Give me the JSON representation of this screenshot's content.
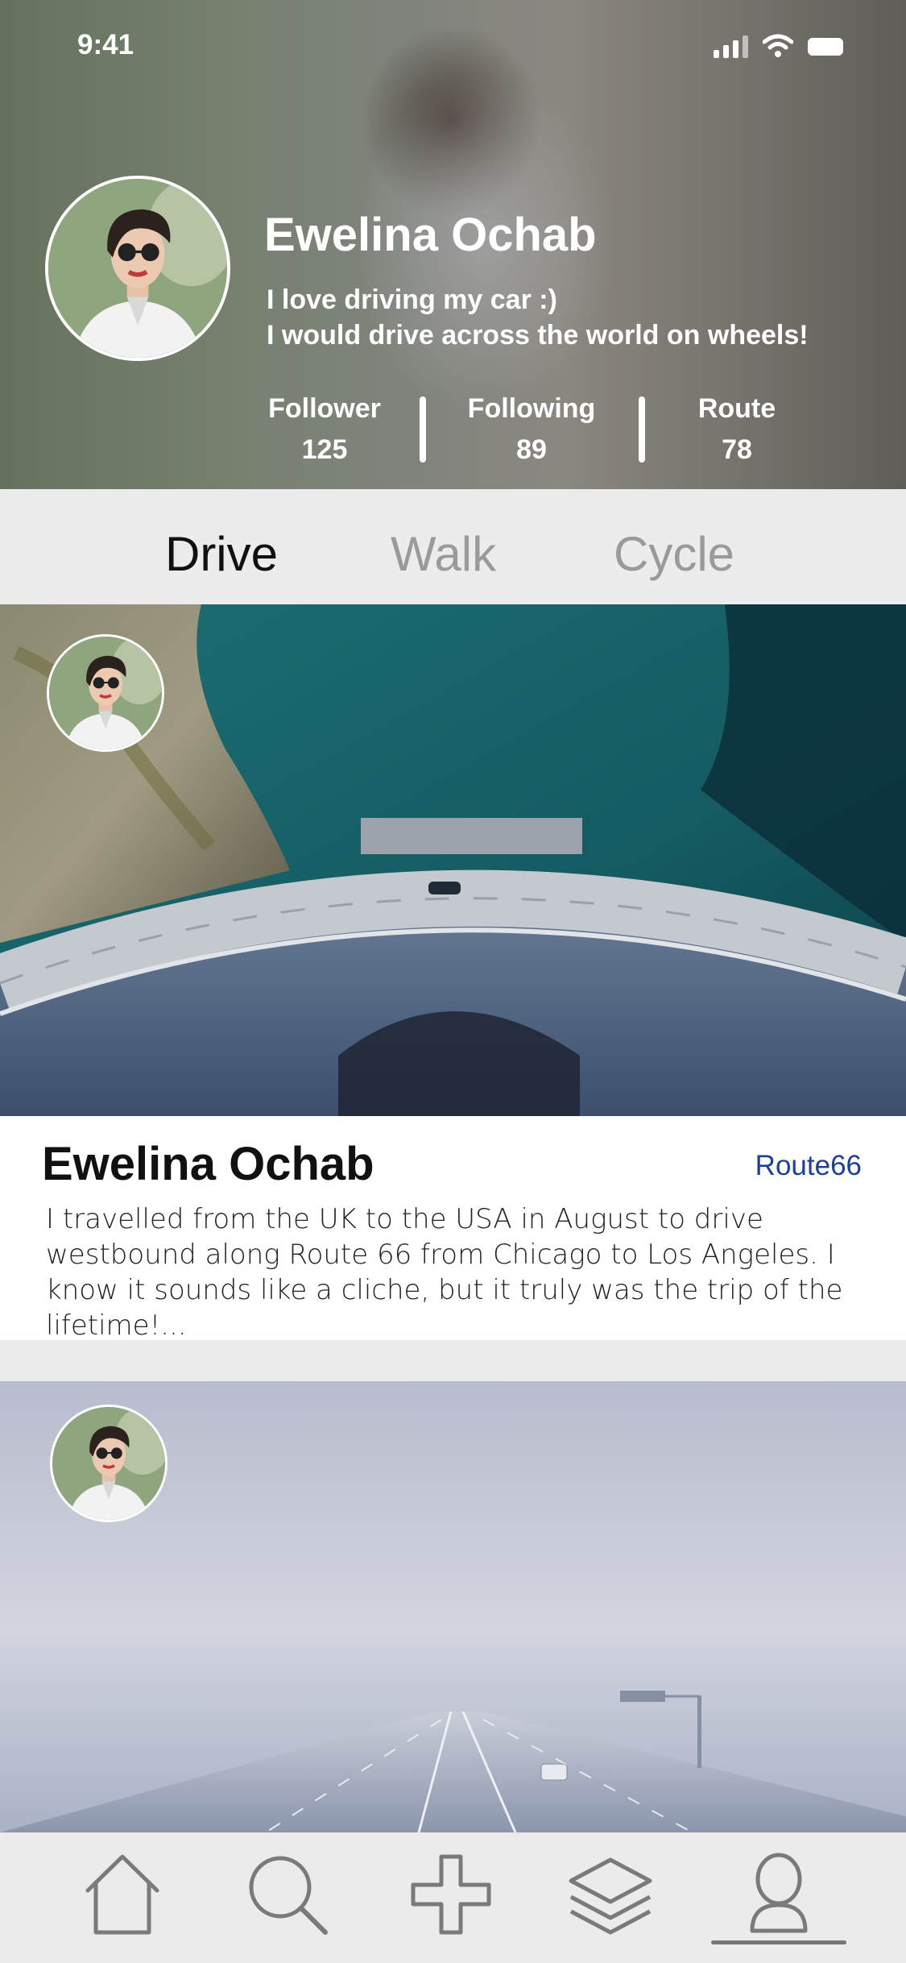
{
  "status_bar": {
    "time": "9:41"
  },
  "profile": {
    "name": "Ewelina Ochab",
    "bio_line1": "I love driving my car :)",
    "bio_line2": "I would drive across the world on wheels!",
    "stats": [
      {
        "label": "Follower",
        "value": "125"
      },
      {
        "label": "Following",
        "value": "89"
      },
      {
        "label": "Route",
        "value": "78"
      }
    ]
  },
  "tabs": {
    "selected": "Drive",
    "items": [
      "Drive",
      "Walk",
      "Cycle"
    ]
  },
  "feed": [
    {
      "author": "Ewelina Ochab",
      "tag": "Route66",
      "text": "I travelled from the UK to the USA in August to drive westbound along Route 66 from Chicago to Los Angeles. I know it sounds like a cliche, but it truly was the trip of the lifetime!..."
    }
  ],
  "bottom_nav": {
    "items": [
      "home-icon",
      "search-icon",
      "add-icon",
      "layers-icon",
      "profile-icon"
    ],
    "active": "profile-icon"
  },
  "colors": {
    "tag_link": "#1b3f9a",
    "tab_inactive": "#9a9a9a",
    "tab_active": "#111111"
  }
}
